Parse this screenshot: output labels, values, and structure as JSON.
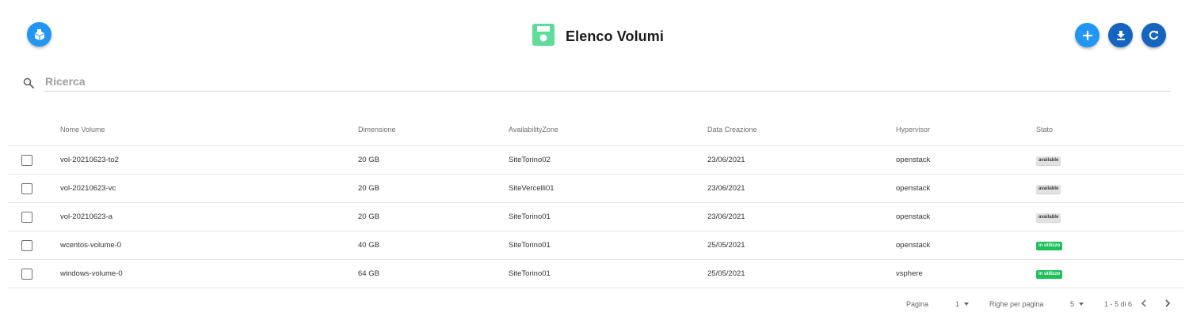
{
  "header": {
    "title": "Elenco Volumi",
    "logo_icon": "box-logo-icon",
    "title_icon": "floppy-save-icon",
    "actions": [
      {
        "name": "add-volume-button",
        "icon": "plus-icon",
        "color": "#2196f3"
      },
      {
        "name": "download-button",
        "icon": "download-icon",
        "color": "#1565c0"
      },
      {
        "name": "refresh-button",
        "icon": "refresh-icon",
        "color": "#1565c0"
      }
    ]
  },
  "search": {
    "placeholder": "Ricerca",
    "value": "",
    "icon": "search-icon"
  },
  "table": {
    "columns": [
      "Nome Volume",
      "Dimensione",
      "AvailabilityZone",
      "Data Creazione",
      "Hypervisor",
      "Stato"
    ],
    "rows": [
      {
        "name": "vol-20210623-to2",
        "size": "20 GB",
        "zone": "SiteTorino02",
        "date": "23/06/2021",
        "hypervisor": "openstack",
        "status": "available",
        "status_color": "#e2e2e2"
      },
      {
        "name": "vol-20210623-vc",
        "size": "20 GB",
        "zone": "SiteVercelli01",
        "date": "23/06/2021",
        "hypervisor": "openstack",
        "status": "available",
        "status_color": "#e2e2e2"
      },
      {
        "name": "vol-20210623-a",
        "size": "20 GB",
        "zone": "SiteTorino01",
        "date": "23/06/2021",
        "hypervisor": "openstack",
        "status": "available",
        "status_color": "#e2e2e2"
      },
      {
        "name": "wcentos-volume-0",
        "size": "40 GB",
        "zone": "SiteTorino01",
        "date": "25/05/2021",
        "hypervisor": "openstack",
        "status": "in utilizzo",
        "status_color": "#1ec05a"
      },
      {
        "name": "windows-volume-0",
        "size": "64 GB",
        "zone": "SiteTorino01",
        "date": "25/05/2021",
        "hypervisor": "vsphere",
        "status": "in utilizzo",
        "status_color": "#1ec05a"
      }
    ]
  },
  "pagination": {
    "page_label": "Pagina",
    "page_value": "1",
    "rows_label": "Righe per pagina",
    "rows_value": "5",
    "range_text": "1 - 5 di 6",
    "prev_icon": "chevron-left-icon",
    "next_icon": "chevron-right-icon"
  },
  "colors": {
    "primary": "#2196f3",
    "primary_dark": "#1565c0",
    "title_icon": "#5fdc9c",
    "success": "#1ec05a"
  }
}
